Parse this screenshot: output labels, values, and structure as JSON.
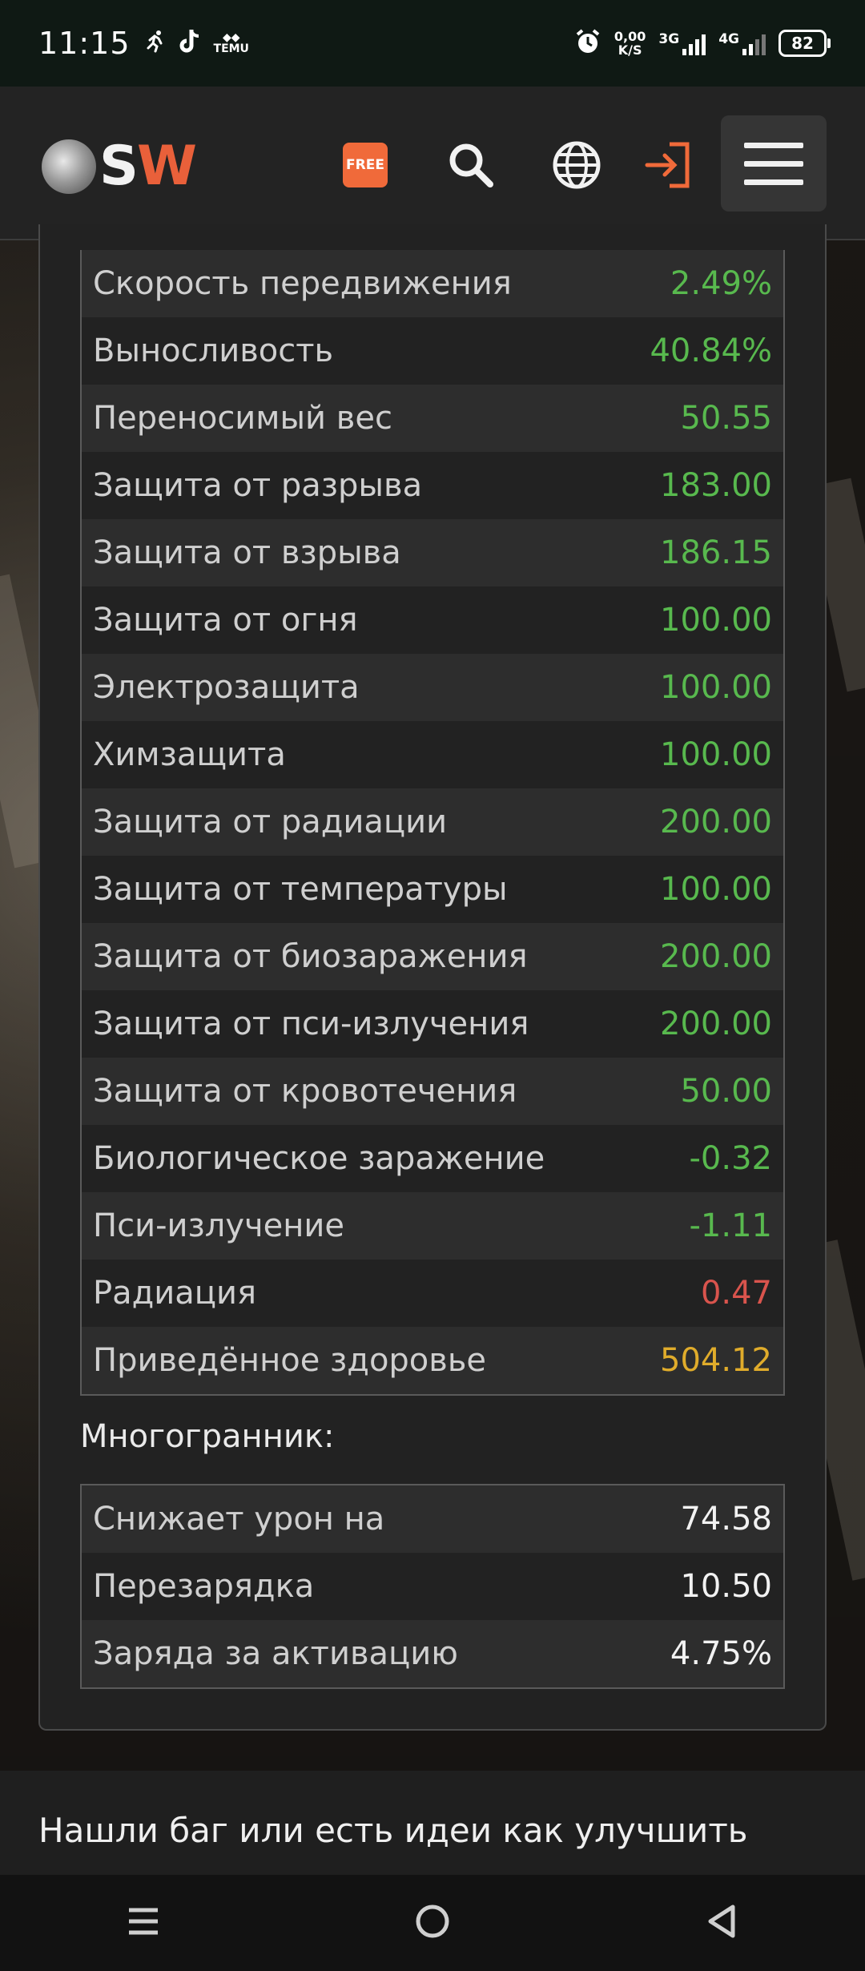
{
  "status_bar": {
    "time": "11:15",
    "icons": [
      "running-icon",
      "tiktok-icon",
      "temu-icon"
    ],
    "temu_label": "TEMU",
    "speed_value": "0,00",
    "speed_unit": "K/S",
    "net1": "3G",
    "net2": "4G",
    "battery": "82"
  },
  "header": {
    "logo_text_s": "S",
    "logo_text_w": "W",
    "free_label": "FREE",
    "icons": [
      "search-icon",
      "globe-icon",
      "login-icon",
      "menu-icon"
    ]
  },
  "stats": [
    {
      "label": "Скорость передвижения",
      "value": "2.49%",
      "color": "green"
    },
    {
      "label": "Выносливость",
      "value": "40.84%",
      "color": "green"
    },
    {
      "label": "Переносимый вес",
      "value": "50.55",
      "color": "green"
    },
    {
      "label": "Защита от разрыва",
      "value": "183.00",
      "color": "green"
    },
    {
      "label": "Защита от взрыва",
      "value": "186.15",
      "color": "green"
    },
    {
      "label": "Защита от огня",
      "value": "100.00",
      "color": "green"
    },
    {
      "label": "Электрозащита",
      "value": "100.00",
      "color": "green"
    },
    {
      "label": "Химзащита",
      "value": "100.00",
      "color": "green"
    },
    {
      "label": "Защита от радиации",
      "value": "200.00",
      "color": "green"
    },
    {
      "label": "Защита от температуры",
      "value": "100.00",
      "color": "green"
    },
    {
      "label": "Защита от биозаражения",
      "value": "200.00",
      "color": "green"
    },
    {
      "label": "Защита от пси-излучения",
      "value": "200.00",
      "color": "green"
    },
    {
      "label": "Защита от кровотечения",
      "value": "50.00",
      "color": "green"
    },
    {
      "label": "Биологическое заражение",
      "value": "-0.32",
      "color": "green"
    },
    {
      "label": "Пси-излучение",
      "value": "-1.11",
      "color": "green"
    },
    {
      "label": "Радиация",
      "value": "0.47",
      "color": "red"
    },
    {
      "label": "Приведённое здоровье",
      "value": "504.12",
      "color": "yellow"
    }
  ],
  "colors": {
    "green": "#58b94e",
    "red": "#d9544d",
    "yellow": "#e0ac2b",
    "accent": "#f06a3a"
  },
  "polyhedron": {
    "title": "Многогранник:",
    "rows": [
      {
        "label": "Снижает урон на",
        "value": "74.58"
      },
      {
        "label": "Перезарядка",
        "value": "10.50"
      },
      {
        "label": "Заряда за активацию",
        "value": "4.75%"
      }
    ]
  },
  "footer": {
    "text": "Нашли баг или есть идеи как улучшить"
  },
  "nav": {
    "icons": [
      "recent-apps-icon",
      "home-icon",
      "back-icon"
    ]
  }
}
